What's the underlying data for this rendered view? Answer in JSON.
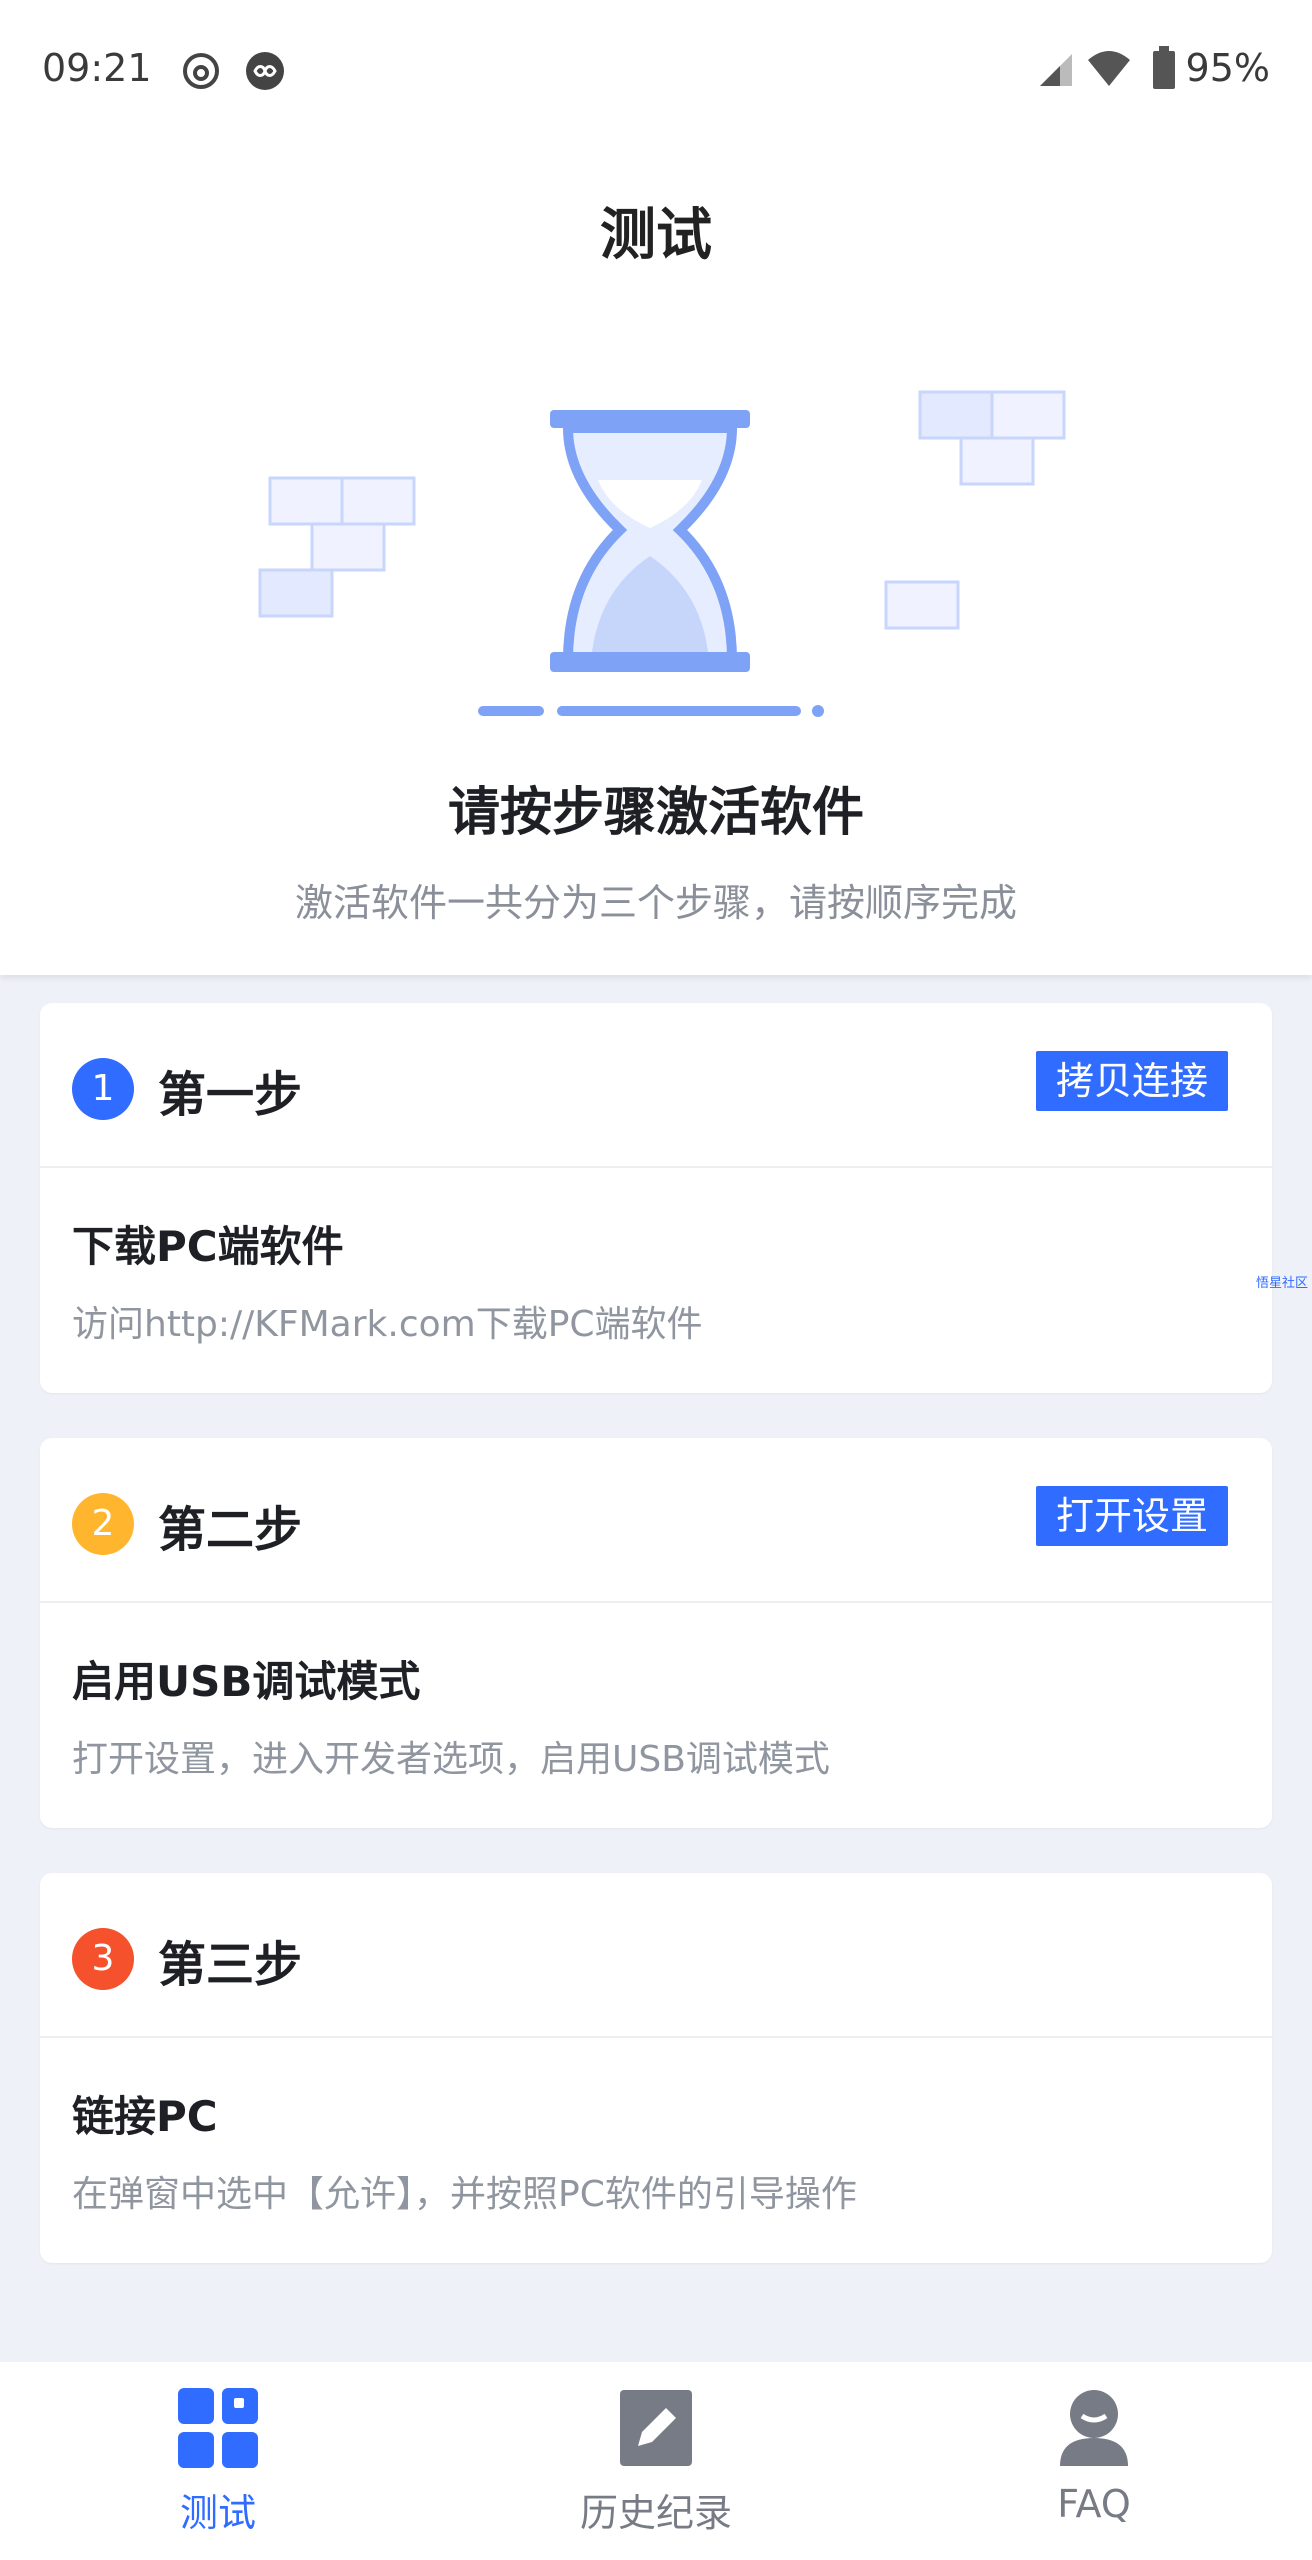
{
  "status_bar": {
    "time": "09:21",
    "battery": "95%"
  },
  "header": {
    "title": "测试"
  },
  "intro": {
    "headline": "请按步骤激活软件",
    "subline": "激活软件一共分为三个步骤，请按顺序完成"
  },
  "steps": [
    {
      "number": "1",
      "title": "第一步",
      "action": "拷贝连接",
      "body_title": "下载PC端软件",
      "body_desc": "访问http://KFMark.com下载PC端软件",
      "color": "#2f6cff"
    },
    {
      "number": "2",
      "title": "第二步",
      "action": "打开设置",
      "body_title": "启用USB调试模式",
      "body_desc": "打开设置，进入开发者选项，启用USB调试模式",
      "color": "#ffb62e"
    },
    {
      "number": "3",
      "title": "第三步",
      "body_title": "链接PC",
      "body_desc": "在弹窗中选中【允许】，并按照PC软件的引导操作",
      "color": "#f4512c"
    }
  ],
  "watermark": "悟星社区",
  "bottom_nav": {
    "items": [
      {
        "label": "测试",
        "icon": "grid-icon",
        "active": true
      },
      {
        "label": "历史纪录",
        "icon": "edit-icon",
        "active": false
      },
      {
        "label": "FAQ",
        "icon": "user-support-icon",
        "active": false
      }
    ],
    "active_color": "#2f6cff",
    "inactive_color": "#777b85"
  }
}
